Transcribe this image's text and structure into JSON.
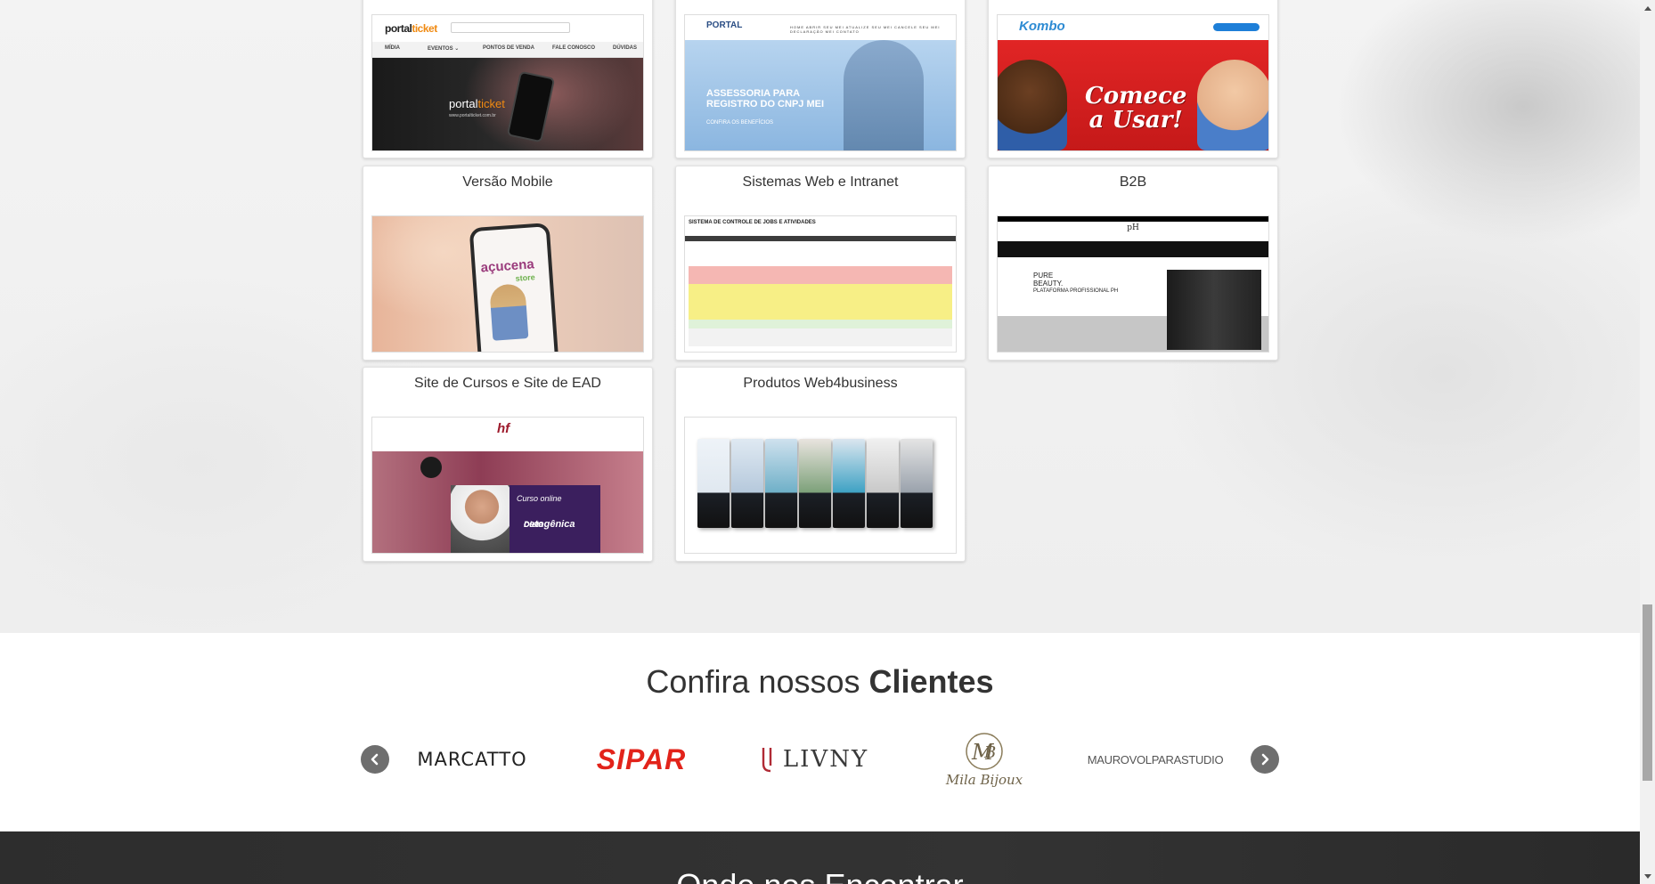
{
  "portfolio": {
    "cards": [
      {
        "title": "",
        "thumb": "portalticket"
      },
      {
        "title": "",
        "thumb": "portal-mei"
      },
      {
        "title": "",
        "thumb": "kombo"
      },
      {
        "title": "Versão Mobile",
        "thumb": "acucena"
      },
      {
        "title": "Sistemas Web e Intranet",
        "thumb": "jobs"
      },
      {
        "title": "B2B",
        "thumb": "ph"
      },
      {
        "title": "Site de Cursos e Site de EAD",
        "thumb": "ead"
      },
      {
        "title": "Produtos Web4business",
        "thumb": "produtos"
      }
    ],
    "thumb_text": {
      "portal_logo_a": "portal",
      "portal_logo_b": "ticket",
      "portal_nav": [
        "MÍDIA",
        "EVENTOS ⌄",
        "PONTOS DE VENDA",
        "FALE CONOSCO",
        "DÚVIDAS"
      ],
      "portal_url": "www.portalticket.com.br",
      "mei_logo": "PORTAL",
      "mei_nav": "HOME   ABRIR SEU MEI   ATUALIZE SEU MEI   CANCELE SEU MEI   DECLARAÇÃO MEI   CONTATO",
      "mei_headline_1": "ASSESSORIA PARA",
      "mei_headline_2": "REGISTRO DO CNPJ MEI",
      "mei_cta": "CONFIRA OS BENEFÍCIOS",
      "kombo_logo": "Kombo",
      "kombo_slogan_1": "Comece",
      "kombo_slogan_2": "a Usar!",
      "mobile_brand": "açucena",
      "mobile_sub": "store",
      "jobs_header": "SISTEMA DE CONTROLE DE JOBS E ATIVIDADES",
      "b2b_logo": "pH",
      "b2b_pure_1": "PURE",
      "b2b_pure_2": "BEAUTY.",
      "b2b_pure_3": "PLATAFORMA PROFISSIONAL PH",
      "ead_logo": "hf",
      "ead_course_1": "Curso online",
      "ead_course_2": "Dieta",
      "ead_course_3": "cetogênica"
    }
  },
  "clients": {
    "title_prefix": "Confira nossos ",
    "title_bold": "Clientes",
    "prev_icon": "chevron-left-icon",
    "next_icon": "chevron-right-icon",
    "logos": [
      {
        "name": "MARCATTO",
        "color": "#222222"
      },
      {
        "name": "SIPAR",
        "color": "#e2231a"
      },
      {
        "name": "LIVNY",
        "color": "#3a3a3a"
      },
      {
        "name": "Mila Bijoux",
        "color": "#6e6248"
      },
      {
        "name": "MAUROVOLPARASTUDIO",
        "color": "#555555"
      }
    ]
  },
  "footer": {
    "title": "Onde nos Encontrar"
  },
  "colors": {
    "card_border": "#e2e2e2",
    "text": "#333333",
    "arrow_button": "#6e6e6e",
    "footer_bg": "#2f2f2f"
  }
}
